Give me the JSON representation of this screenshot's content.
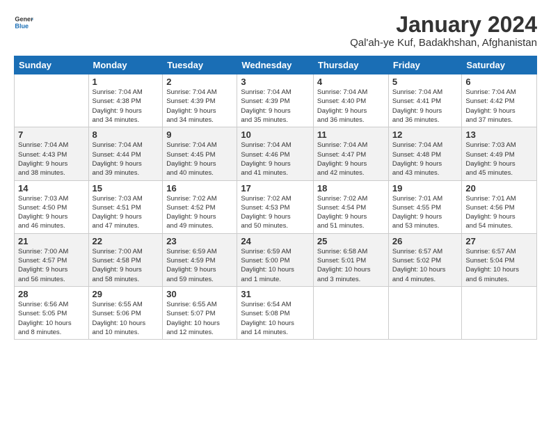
{
  "logo": {
    "line1": "General",
    "line2": "Blue"
  },
  "title": "January 2024",
  "subtitle": "Qal'ah-ye Kuf, Badakhshan, Afghanistan",
  "header_days": [
    "Sunday",
    "Monday",
    "Tuesday",
    "Wednesday",
    "Thursday",
    "Friday",
    "Saturday"
  ],
  "weeks": [
    [
      {
        "day": "",
        "info": ""
      },
      {
        "day": "1",
        "info": "Sunrise: 7:04 AM\nSunset: 4:38 PM\nDaylight: 9 hours\nand 34 minutes."
      },
      {
        "day": "2",
        "info": "Sunrise: 7:04 AM\nSunset: 4:39 PM\nDaylight: 9 hours\nand 34 minutes."
      },
      {
        "day": "3",
        "info": "Sunrise: 7:04 AM\nSunset: 4:39 PM\nDaylight: 9 hours\nand 35 minutes."
      },
      {
        "day": "4",
        "info": "Sunrise: 7:04 AM\nSunset: 4:40 PM\nDaylight: 9 hours\nand 36 minutes."
      },
      {
        "day": "5",
        "info": "Sunrise: 7:04 AM\nSunset: 4:41 PM\nDaylight: 9 hours\nand 36 minutes."
      },
      {
        "day": "6",
        "info": "Sunrise: 7:04 AM\nSunset: 4:42 PM\nDaylight: 9 hours\nand 37 minutes."
      }
    ],
    [
      {
        "day": "7",
        "info": "Sunrise: 7:04 AM\nSunset: 4:43 PM\nDaylight: 9 hours\nand 38 minutes."
      },
      {
        "day": "8",
        "info": "Sunrise: 7:04 AM\nSunset: 4:44 PM\nDaylight: 9 hours\nand 39 minutes."
      },
      {
        "day": "9",
        "info": "Sunrise: 7:04 AM\nSunset: 4:45 PM\nDaylight: 9 hours\nand 40 minutes."
      },
      {
        "day": "10",
        "info": "Sunrise: 7:04 AM\nSunset: 4:46 PM\nDaylight: 9 hours\nand 41 minutes."
      },
      {
        "day": "11",
        "info": "Sunrise: 7:04 AM\nSunset: 4:47 PM\nDaylight: 9 hours\nand 42 minutes."
      },
      {
        "day": "12",
        "info": "Sunrise: 7:04 AM\nSunset: 4:48 PM\nDaylight: 9 hours\nand 43 minutes."
      },
      {
        "day": "13",
        "info": "Sunrise: 7:03 AM\nSunset: 4:49 PM\nDaylight: 9 hours\nand 45 minutes."
      }
    ],
    [
      {
        "day": "14",
        "info": "Sunrise: 7:03 AM\nSunset: 4:50 PM\nDaylight: 9 hours\nand 46 minutes."
      },
      {
        "day": "15",
        "info": "Sunrise: 7:03 AM\nSunset: 4:51 PM\nDaylight: 9 hours\nand 47 minutes."
      },
      {
        "day": "16",
        "info": "Sunrise: 7:02 AM\nSunset: 4:52 PM\nDaylight: 9 hours\nand 49 minutes."
      },
      {
        "day": "17",
        "info": "Sunrise: 7:02 AM\nSunset: 4:53 PM\nDaylight: 9 hours\nand 50 minutes."
      },
      {
        "day": "18",
        "info": "Sunrise: 7:02 AM\nSunset: 4:54 PM\nDaylight: 9 hours\nand 51 minutes."
      },
      {
        "day": "19",
        "info": "Sunrise: 7:01 AM\nSunset: 4:55 PM\nDaylight: 9 hours\nand 53 minutes."
      },
      {
        "day": "20",
        "info": "Sunrise: 7:01 AM\nSunset: 4:56 PM\nDaylight: 9 hours\nand 54 minutes."
      }
    ],
    [
      {
        "day": "21",
        "info": "Sunrise: 7:00 AM\nSunset: 4:57 PM\nDaylight: 9 hours\nand 56 minutes."
      },
      {
        "day": "22",
        "info": "Sunrise: 7:00 AM\nSunset: 4:58 PM\nDaylight: 9 hours\nand 58 minutes."
      },
      {
        "day": "23",
        "info": "Sunrise: 6:59 AM\nSunset: 4:59 PM\nDaylight: 9 hours\nand 59 minutes."
      },
      {
        "day": "24",
        "info": "Sunrise: 6:59 AM\nSunset: 5:00 PM\nDaylight: 10 hours\nand 1 minute."
      },
      {
        "day": "25",
        "info": "Sunrise: 6:58 AM\nSunset: 5:01 PM\nDaylight: 10 hours\nand 3 minutes."
      },
      {
        "day": "26",
        "info": "Sunrise: 6:57 AM\nSunset: 5:02 PM\nDaylight: 10 hours\nand 4 minutes."
      },
      {
        "day": "27",
        "info": "Sunrise: 6:57 AM\nSunset: 5:04 PM\nDaylight: 10 hours\nand 6 minutes."
      }
    ],
    [
      {
        "day": "28",
        "info": "Sunrise: 6:56 AM\nSunset: 5:05 PM\nDaylight: 10 hours\nand 8 minutes."
      },
      {
        "day": "29",
        "info": "Sunrise: 6:55 AM\nSunset: 5:06 PM\nDaylight: 10 hours\nand 10 minutes."
      },
      {
        "day": "30",
        "info": "Sunrise: 6:55 AM\nSunset: 5:07 PM\nDaylight: 10 hours\nand 12 minutes."
      },
      {
        "day": "31",
        "info": "Sunrise: 6:54 AM\nSunset: 5:08 PM\nDaylight: 10 hours\nand 14 minutes."
      },
      {
        "day": "",
        "info": ""
      },
      {
        "day": "",
        "info": ""
      },
      {
        "day": "",
        "info": ""
      }
    ]
  ]
}
